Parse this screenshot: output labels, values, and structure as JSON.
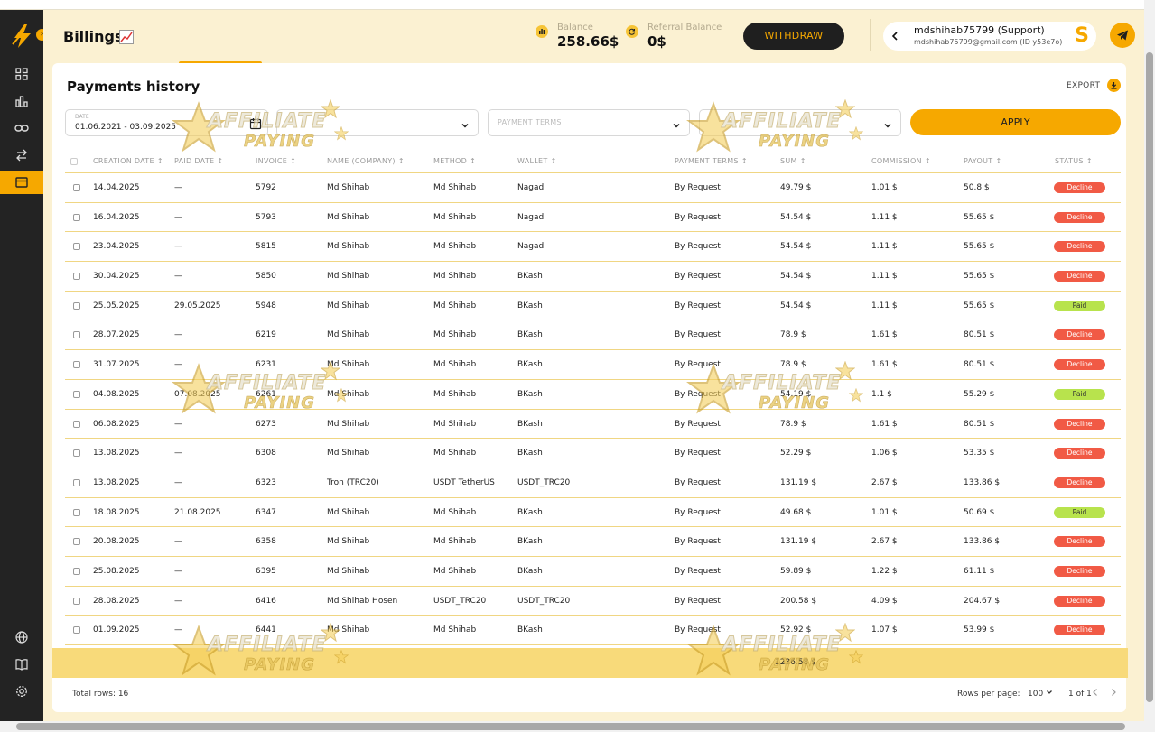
{
  "header": {
    "title": "Billings",
    "balance_label": "Balance",
    "balance_value": "258.66$",
    "referral_label": "Referral Balance",
    "referral_value": "0$",
    "withdraw_label": "WITHDRAW",
    "user_name": "mdshihab75799 (Support)",
    "user_email": "mdshihab75799@gmail.com (ID y53e7o)",
    "user_avatar_letter": "S"
  },
  "card": {
    "title": "Payments history",
    "export_label": "EXPORT"
  },
  "filters": {
    "date_label": "DATE",
    "date_value": "01.06.2021 - 03.09.2025",
    "payment_terms_placeholder": "PAYMENT TERMS",
    "apply_label": "APPLY"
  },
  "columns": [
    "CREATION DATE",
    "PAID DATE",
    "INVOICE",
    "NAME (COMPANY)",
    "METHOD",
    "WALLET",
    "PAYMENT TERMS",
    "SUM",
    "COMMISSION",
    "PAYOUT",
    "STATUS"
  ],
  "rows": [
    {
      "created": "14.04.2025",
      "paid": "—",
      "invoice": "5792",
      "name": "Md Shihab",
      "method": "Md Shihab",
      "wallet": "Nagad",
      "terms": "By Request",
      "sum": "49.79 $",
      "commission": "1.01 $",
      "payout": "50.8 $",
      "status": "Decline"
    },
    {
      "created": "16.04.2025",
      "paid": "—",
      "invoice": "5793",
      "name": "Md Shihab",
      "method": "Md Shihab",
      "wallet": "Nagad",
      "terms": "By Request",
      "sum": "54.54 $",
      "commission": "1.11 $",
      "payout": "55.65 $",
      "status": "Decline"
    },
    {
      "created": "23.04.2025",
      "paid": "—",
      "invoice": "5815",
      "name": "Md Shihab",
      "method": "Md Shihab",
      "wallet": "Nagad",
      "terms": "By Request",
      "sum": "54.54 $",
      "commission": "1.11 $",
      "payout": "55.65 $",
      "status": "Decline"
    },
    {
      "created": "30.04.2025",
      "paid": "—",
      "invoice": "5850",
      "name": "Md Shihab",
      "method": "Md Shihab",
      "wallet": "BKash",
      "terms": "By Request",
      "sum": "54.54 $",
      "commission": "1.11 $",
      "payout": "55.65 $",
      "status": "Decline"
    },
    {
      "created": "25.05.2025",
      "paid": "29.05.2025",
      "invoice": "5948",
      "name": "Md Shihab",
      "method": "Md Shihab",
      "wallet": "BKash",
      "terms": "By Request",
      "sum": "54.54 $",
      "commission": "1.11 $",
      "payout": "55.65 $",
      "status": "Paid"
    },
    {
      "created": "28.07.2025",
      "paid": "—",
      "invoice": "6219",
      "name": "Md Shihab",
      "method": "Md Shihab",
      "wallet": "BKash",
      "terms": "By Request",
      "sum": "78.9 $",
      "commission": "1.61 $",
      "payout": "80.51 $",
      "status": "Decline"
    },
    {
      "created": "31.07.2025",
      "paid": "—",
      "invoice": "6231",
      "name": "Md Shihab",
      "method": "Md Shihab",
      "wallet": "BKash",
      "terms": "By Request",
      "sum": "78.9 $",
      "commission": "1.61 $",
      "payout": "80.51 $",
      "status": "Decline"
    },
    {
      "created": "04.08.2025",
      "paid": "07.08.2025",
      "invoice": "6261",
      "name": "Md Shihab",
      "method": "Md Shihab",
      "wallet": "BKash",
      "terms": "By Request",
      "sum": "54.19 $",
      "commission": "1.1 $",
      "payout": "55.29 $",
      "status": "Paid"
    },
    {
      "created": "06.08.2025",
      "paid": "—",
      "invoice": "6273",
      "name": "Md Shihab",
      "method": "Md Shihab",
      "wallet": "BKash",
      "terms": "By Request",
      "sum": "78.9 $",
      "commission": "1.61 $",
      "payout": "80.51 $",
      "status": "Decline"
    },
    {
      "created": "13.08.2025",
      "paid": "—",
      "invoice": "6308",
      "name": "Md Shihab",
      "method": "Md Shihab",
      "wallet": "BKash",
      "terms": "By Request",
      "sum": "52.29 $",
      "commission": "1.06 $",
      "payout": "53.35 $",
      "status": "Decline"
    },
    {
      "created": "13.08.2025",
      "paid": "—",
      "invoice": "6323",
      "name": "Tron (TRC20)",
      "method": "USDT TetherUS",
      "wallet": "USDT_TRC20",
      "terms": "By Request",
      "sum": "131.19 $",
      "commission": "2.67 $",
      "payout": "133.86 $",
      "status": "Decline"
    },
    {
      "created": "18.08.2025",
      "paid": "21.08.2025",
      "invoice": "6347",
      "name": "Md Shihab",
      "method": "Md Shihab",
      "wallet": "BKash",
      "terms": "By Request",
      "sum": "49.68 $",
      "commission": "1.01 $",
      "payout": "50.69 $",
      "status": "Paid"
    },
    {
      "created": "20.08.2025",
      "paid": "—",
      "invoice": "6358",
      "name": "Md Shihab",
      "method": "Md Shihab",
      "wallet": "BKash",
      "terms": "By Request",
      "sum": "131.19 $",
      "commission": "2.67 $",
      "payout": "133.86 $",
      "status": "Decline"
    },
    {
      "created": "25.08.2025",
      "paid": "—",
      "invoice": "6395",
      "name": "Md Shihab",
      "method": "Md Shihab",
      "wallet": "BKash",
      "terms": "By Request",
      "sum": "59.89 $",
      "commission": "1.22 $",
      "payout": "61.11 $",
      "status": "Decline"
    },
    {
      "created": "28.08.2025",
      "paid": "—",
      "invoice": "6416",
      "name": "Md Shihab Hosen",
      "method": "USDT_TRC20",
      "wallet": "USDT_TRC20",
      "terms": "By Request",
      "sum": "200.58 $",
      "commission": "4.09 $",
      "payout": "204.67 $",
      "status": "Decline"
    },
    {
      "created": "01.09.2025",
      "paid": "—",
      "invoice": "6441",
      "name": "Md Shihab",
      "method": "Md Shihab",
      "wallet": "BKash",
      "terms": "By Request",
      "sum": "52.92 $",
      "commission": "1.07 $",
      "payout": "53.99 $",
      "status": "Decline"
    }
  ],
  "totals": {
    "sum": "1236.58 $"
  },
  "footer": {
    "total_rows": "Total rows: 16",
    "rows_per_page_label": "Rows per page:",
    "rows_per_page_value": "100",
    "page_info": "1 of 1"
  },
  "watermark": {
    "line1": "AFFILIATE",
    "line2": "PAYING"
  },
  "colors": {
    "accent": "#f6a800",
    "decline": "#f15a45",
    "paid": "#b8e34d",
    "sidebar": "#232323",
    "page_bg": "#fbf1d2"
  }
}
